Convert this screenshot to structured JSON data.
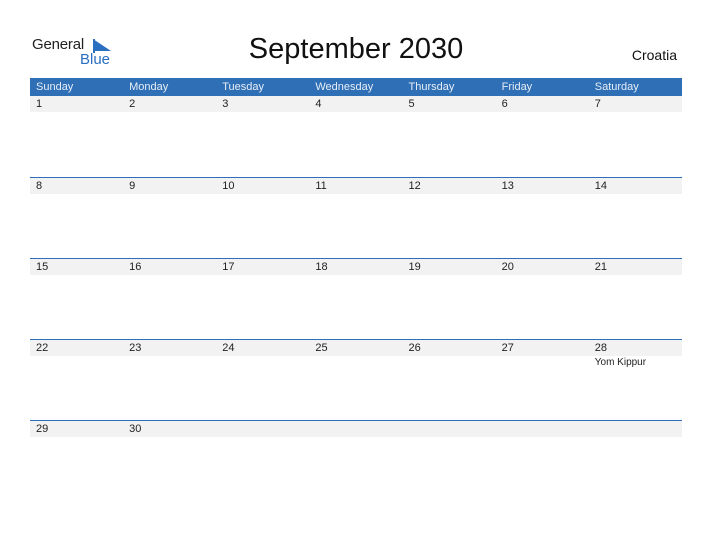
{
  "logo": {
    "part1": "General",
    "part2": "Blue",
    "color": "#2a6fc0"
  },
  "title": "September 2030",
  "country": "Croatia",
  "accent_color": "#2e6fb5",
  "weekdays": [
    "Sunday",
    "Monday",
    "Tuesday",
    "Wednesday",
    "Thursday",
    "Friday",
    "Saturday"
  ],
  "weeks": [
    {
      "days": [
        "1",
        "2",
        "3",
        "4",
        "5",
        "6",
        "7"
      ],
      "events": [
        "",
        "",
        "",
        "",
        "",
        "",
        ""
      ]
    },
    {
      "days": [
        "8",
        "9",
        "10",
        "11",
        "12",
        "13",
        "14"
      ],
      "events": [
        "",
        "",
        "",
        "",
        "",
        "",
        ""
      ]
    },
    {
      "days": [
        "15",
        "16",
        "17",
        "18",
        "19",
        "20",
        "21"
      ],
      "events": [
        "",
        "",
        "",
        "",
        "",
        "",
        ""
      ]
    },
    {
      "days": [
        "22",
        "23",
        "24",
        "25",
        "26",
        "27",
        "28"
      ],
      "events": [
        "",
        "",
        "",
        "",
        "",
        "",
        "Yom Kippur"
      ]
    },
    {
      "days": [
        "29",
        "30",
        "",
        "",
        "",
        "",
        ""
      ],
      "events": [
        "",
        "",
        "",
        "",
        "",
        "",
        ""
      ]
    }
  ]
}
